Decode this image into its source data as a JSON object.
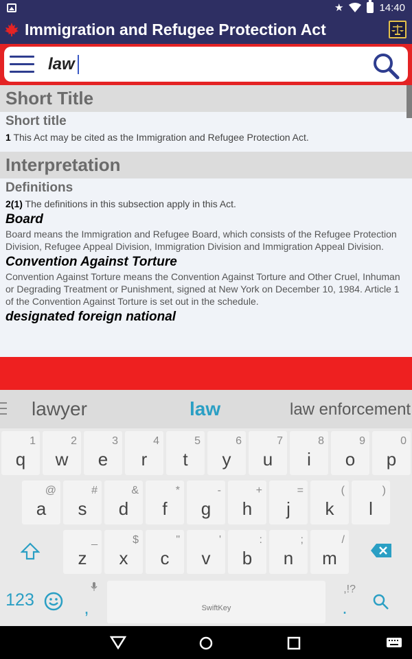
{
  "status_bar": {
    "time": "14:40"
  },
  "app_bar": {
    "title": "Immigration and Refugee Protection Act"
  },
  "search": {
    "value": "law"
  },
  "content": {
    "sections": [
      {
        "heading": "Short Title"
      },
      {
        "heading": "Interpretation"
      }
    ],
    "short_title_sub": "Short title",
    "short_title_num": "1",
    "short_title_text": "This Act may be cited as the Immigration and Refugee Protection Act.",
    "definitions_sub": "Definitions",
    "definitions_num": "2(1)",
    "definitions_text": "The definitions in this subsection apply in this Act.",
    "terms": [
      {
        "term": "Board",
        "definition": "Board means the Immigration and Refugee Board, which consists of the Refugee Protection Division, Refugee Appeal Division, Immigration Division and Immigration Appeal Division."
      },
      {
        "term": "Convention Against Torture",
        "definition": "Convention Against Torture means the Convention Against Torture and Other Cruel, Inhuman or Degrading Treatment or Punishment, signed at New York on December 10, 1984. Article 1 of the Convention Against Torture is set out in the schedule."
      },
      {
        "term": "designated foreign national",
        "definition": ""
      }
    ]
  },
  "suggestions": [
    "lawyer",
    "law",
    "law enforcement"
  ],
  "keyboard": {
    "row1": [
      [
        "q",
        "1"
      ],
      [
        "w",
        "2"
      ],
      [
        "e",
        "3"
      ],
      [
        "r",
        "4"
      ],
      [
        "t",
        "5"
      ],
      [
        "y",
        "6"
      ],
      [
        "u",
        "7"
      ],
      [
        "i",
        "8"
      ],
      [
        "o",
        "9"
      ],
      [
        "p",
        "0"
      ]
    ],
    "row2": [
      [
        "a",
        "@"
      ],
      [
        "s",
        "#"
      ],
      [
        "d",
        "&"
      ],
      [
        "f",
        "*"
      ],
      [
        "g",
        "-"
      ],
      [
        "h",
        "+"
      ],
      [
        "j",
        "="
      ],
      [
        "k",
        "("
      ],
      [
        "l",
        ")"
      ]
    ],
    "row3": [
      [
        "z",
        "_"
      ],
      [
        "x",
        "$"
      ],
      [
        "c",
        "\""
      ],
      [
        "v",
        "'"
      ],
      [
        "b",
        ":"
      ],
      [
        "n",
        ";"
      ],
      [
        "m",
        "/"
      ]
    ],
    "numbers_label": "123",
    "comma": ",",
    "period": ".",
    "period_hint": ",!?",
    "brand": "SwiftKey"
  },
  "colors": {
    "app_bar": "#2e2f63",
    "accent_red": "#ee2020",
    "suggestion_active": "#2a9fc4"
  }
}
